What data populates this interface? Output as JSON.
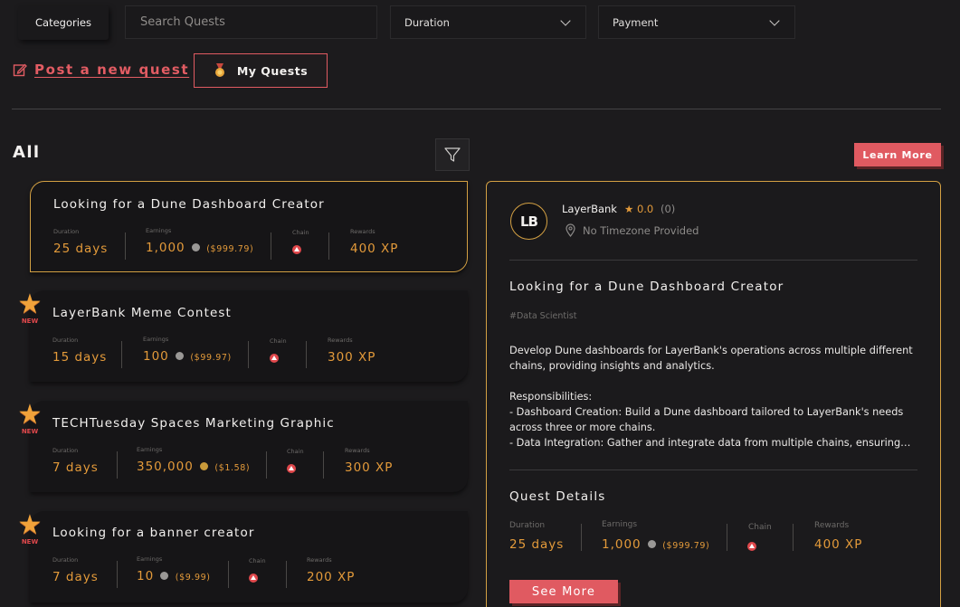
{
  "filters": {
    "categories_label": "Categories",
    "search_placeholder": "Search Quests",
    "duration_label": "Duration",
    "payment_label": "Payment"
  },
  "actions": {
    "post_label": "Post a new quest",
    "my_quests_label": "My Quests",
    "learn_more_label": "Learn More"
  },
  "section_title": "All",
  "stat_labels": {
    "duration": "Duration",
    "earnings": "Earnings",
    "chain": "Chain",
    "rewards": "Rewards"
  },
  "new_badge": "NEW",
  "quests": [
    {
      "title": "Looking for a Dune Dashboard Creator",
      "duration": "25 days",
      "earnings": "1,000",
      "usd": "($999.79)",
      "rewards": "400 XP",
      "coin": "silver",
      "is_new": false
    },
    {
      "title": "LayerBank Meme Contest",
      "duration": "15 days",
      "earnings": "100",
      "usd": "($99.97)",
      "rewards": "300 XP",
      "coin": "silver",
      "is_new": true
    },
    {
      "title": "TECHTuesday Spaces Marketing Graphic",
      "duration": "7 days",
      "earnings": "350,000",
      "usd": "($1.58)",
      "rewards": "300 XP",
      "coin": "gold",
      "is_new": true
    },
    {
      "title": "Looking for a banner creator",
      "duration": "7 days",
      "earnings": "10",
      "usd": "($9.99)",
      "rewards": "200 XP",
      "coin": "silver",
      "is_new": true
    }
  ],
  "detail": {
    "logo_text": "LB",
    "company": "LayerBank",
    "rating": "★ 0.0",
    "rating_count": "(0)",
    "timezone": "No Timezone Provided",
    "title": "Looking for a Dune Dashboard Creator",
    "tag": "#Data Scientist",
    "description": "Develop Dune dashboards for LayerBank's operations across multiple different chains, providing insights and analytics.\n\nResponsibilities:\n- Dashboard Creation: Build a Dune dashboard tailored to LayerBank's needs across three or more chains.\n- Data Integration: Gather and integrate data from multiple chains, ensuring…",
    "details_title": "Quest Details",
    "duration": "25 days",
    "earnings": "1,000",
    "usd": "($999.79)",
    "rewards": "400 XP",
    "see_more_label": "See More"
  },
  "colors": {
    "accent": "#e05a61",
    "gold": "#d3a043",
    "value_orange": "#e39a3a"
  }
}
